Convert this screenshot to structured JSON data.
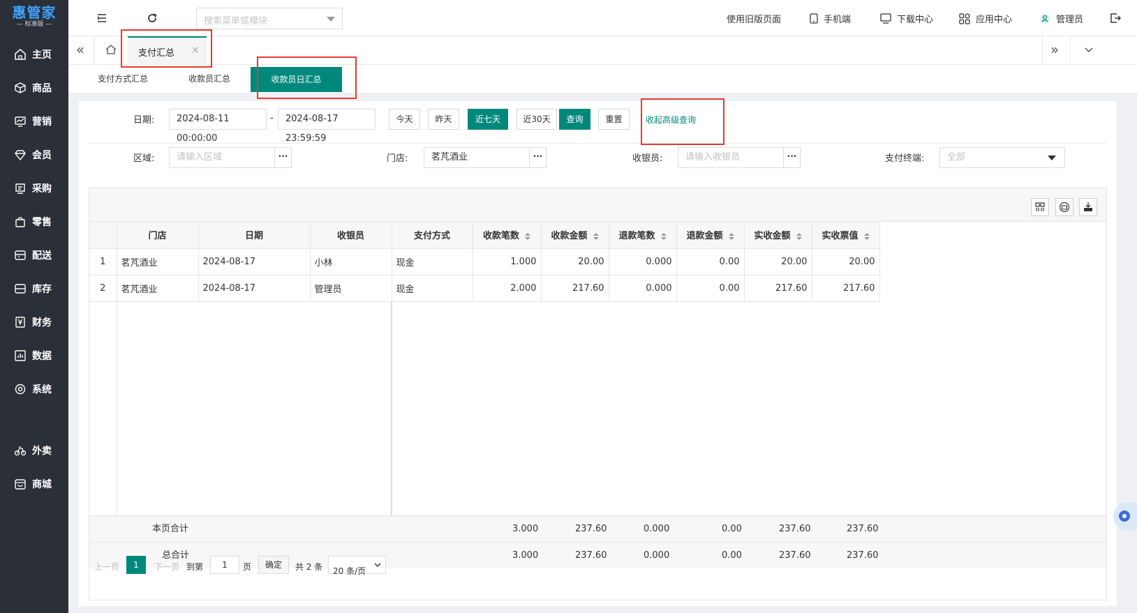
{
  "app": {
    "logo": "惠管家",
    "edition": "— 标准版 —"
  },
  "sidebar": {
    "items": [
      {
        "label": "主页",
        "icon": "home-icon"
      },
      {
        "label": "商品",
        "icon": "cube-icon"
      },
      {
        "label": "营销",
        "icon": "trend-icon"
      },
      {
        "label": "会员",
        "icon": "diamond-icon"
      },
      {
        "label": "采购",
        "icon": "purchase-icon"
      },
      {
        "label": "零售",
        "icon": "bag-icon"
      },
      {
        "label": "配送",
        "icon": "delivery-icon"
      },
      {
        "label": "库存",
        "icon": "stock-icon"
      },
      {
        "label": "财务",
        "icon": "yen-icon"
      },
      {
        "label": "数据",
        "icon": "data-icon"
      },
      {
        "label": "系统",
        "icon": "settings-icon"
      }
    ],
    "extra": [
      {
        "label": "外卖",
        "icon": "bike-icon"
      },
      {
        "label": "商城",
        "icon": "shop-icon"
      }
    ]
  },
  "header": {
    "search_placeholder": "搜索菜单或模块",
    "links": {
      "old": "使用旧版页面",
      "mobile": "手机端",
      "download": "下载中心",
      "apps": "应用中心",
      "user": "管理员"
    }
  },
  "tabs": {
    "open": [
      {
        "label": "支付汇总",
        "close": "×"
      }
    ]
  },
  "subtabs": {
    "items": [
      "支付方式汇总",
      "收款员汇总",
      "收款员日汇总"
    ],
    "active": "收款员日汇总"
  },
  "filters": {
    "date_label": "日期:",
    "date_from": "2024-08-11 00:00:00",
    "date_sep": "-",
    "date_to": "2024-08-17 23:59:59",
    "quick": {
      "today": "今天",
      "yesterday": "昨天",
      "seven": "近七天",
      "thirty": "近30天"
    },
    "query": "查询",
    "reset": "重置",
    "advanced": "收起高级查询",
    "region_label": "区域:",
    "region_placeholder": "请输入区域",
    "store_label": "门店:",
    "store_value": "茗芃酒业",
    "cashier_label": "收银员:",
    "cashier_placeholder": "请输入收银员",
    "terminal_label": "支付终端:",
    "terminal_value": "全部",
    "ellipsis": "···"
  },
  "table": {
    "columns": [
      "门店",
      "日期",
      "收银员",
      "支付方式",
      "收款笔数",
      "收款金额",
      "退款笔数",
      "退款金额",
      "实收金额",
      "实收票值"
    ],
    "rows": [
      {
        "idx": "1",
        "store": "茗芃酒业",
        "date": "2024-08-17",
        "cashier": "小林",
        "method": "现金",
        "count": "1.000",
        "amount": "20.00",
        "refund_count": "0.000",
        "refund_amount": "0.00",
        "net": "20.00",
        "ticket": "20.00"
      },
      {
        "idx": "2",
        "store": "茗芃酒业",
        "date": "2024-08-17",
        "cashier": "管理员",
        "method": "现金",
        "count": "2.000",
        "amount": "217.60",
        "refund_count": "0.000",
        "refund_amount": "0.00",
        "net": "217.60",
        "ticket": "217.60"
      }
    ],
    "page_total": {
      "label": "本页合计",
      "count": "3.000",
      "amount": "237.60",
      "refund_count": "0.000",
      "refund_amount": "0.00",
      "net": "237.60",
      "ticket": "237.60"
    },
    "grand_total": {
      "label": "总合计",
      "count": "3.000",
      "amount": "237.60",
      "refund_count": "0.000",
      "refund_amount": "0.00",
      "net": "237.60",
      "ticket": "237.60"
    }
  },
  "pager": {
    "prev": "上一页",
    "current": "1",
    "next": "下一页",
    "goto": "到第",
    "page_input": "1",
    "page_unit": "页",
    "confirm": "确定",
    "total": "共 2 条",
    "size": "20 条/页"
  },
  "colors": {
    "accent": "#00897b",
    "sidebar": "#2b2f38",
    "highlight": "#e53935"
  }
}
